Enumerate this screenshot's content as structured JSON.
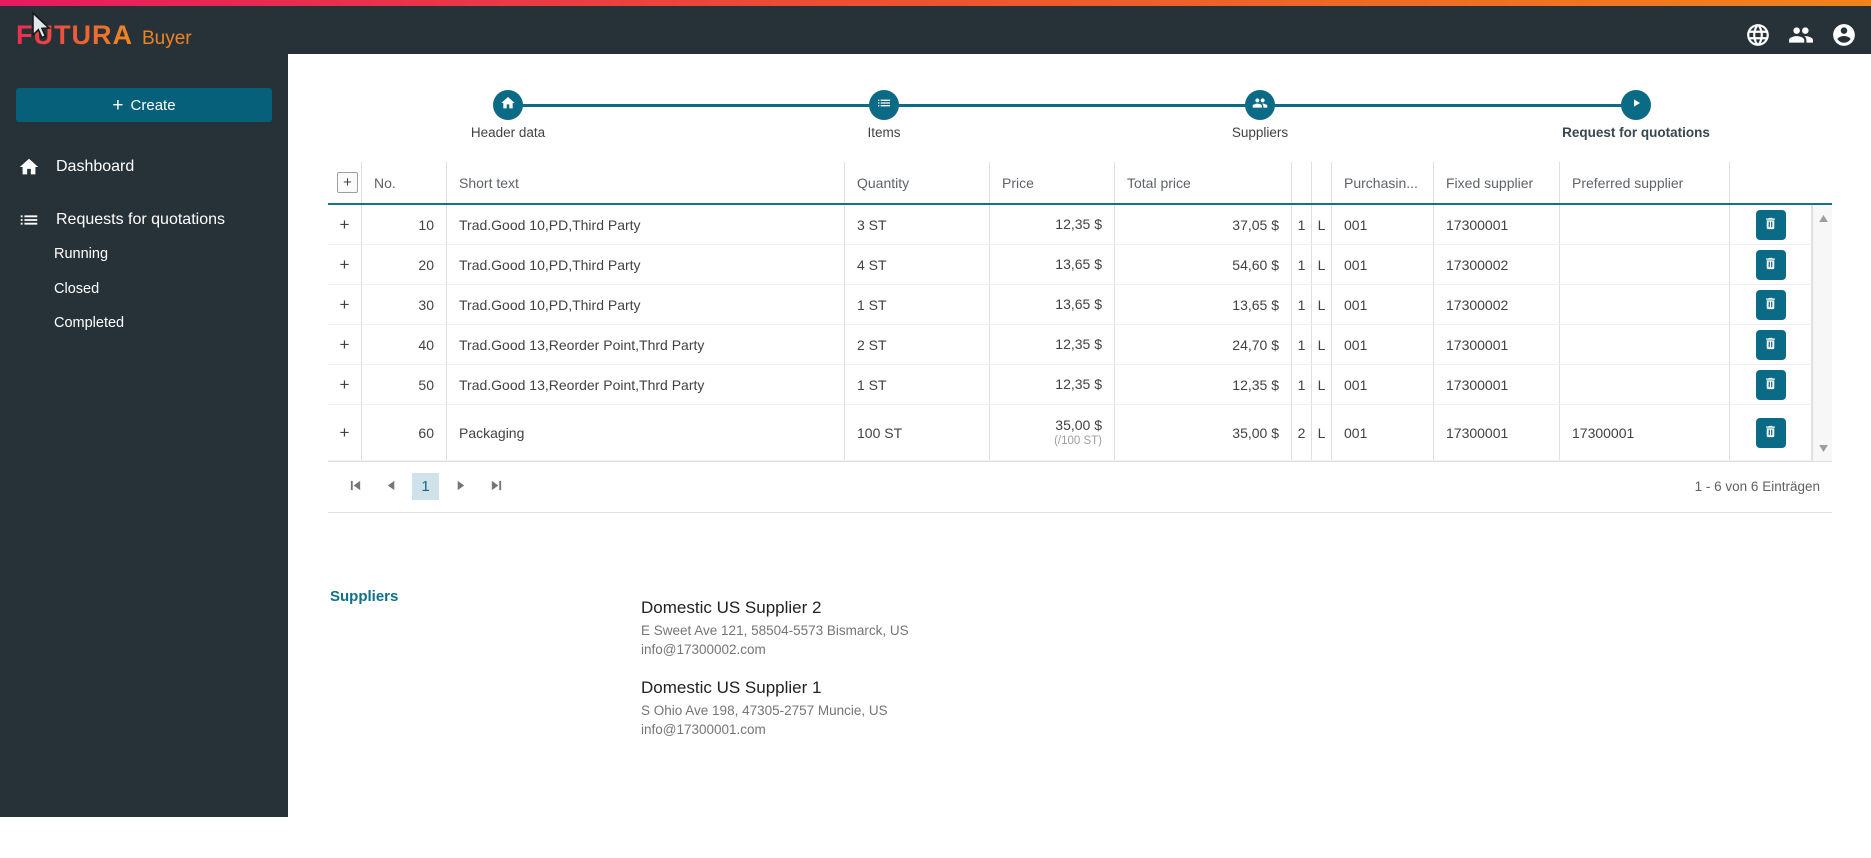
{
  "brand": {
    "name": "FUTURA",
    "suffix": "Buyer"
  },
  "colors": {
    "accent": "#0b6a85",
    "header_bg": "#263238",
    "strip_from": "#e61a5f",
    "strip_to": "#f0831c",
    "page_highlight": "#cfe2ea"
  },
  "icons": {
    "plus": "+",
    "header": [
      "globe-icon",
      "team-icon",
      "account-icon"
    ],
    "sidebar": [
      "home-icon",
      "list-icon"
    ],
    "stepper": [
      "home-icon",
      "list-icon",
      "group-icon",
      "play-circle-icon"
    ],
    "row_action": "trash-icon",
    "collapse": "chevron-left-icon"
  },
  "sidebar": {
    "create_label": "Create",
    "items": [
      {
        "label": "Dashboard"
      },
      {
        "label": "Requests for quotations"
      }
    ],
    "subitems": [
      "Running",
      "Closed",
      "Completed"
    ]
  },
  "stepper": {
    "steps": [
      {
        "label": "Header data"
      },
      {
        "label": "Items"
      },
      {
        "label": "Suppliers"
      },
      {
        "label": "Request for quotations"
      }
    ]
  },
  "table": {
    "headers": {
      "no": "No.",
      "short_text": "Short text",
      "quantity": "Quantity",
      "price": "Price",
      "total_price": "Total price",
      "purchasing": "Purchasin...",
      "fixed_supplier": "Fixed supplier",
      "preferred_supplier": "Preferred supplier"
    },
    "rows": [
      {
        "no": "10",
        "short_text": "Trad.Good 10,PD,Third Party",
        "quantity": "3 ST",
        "price": "12,35 $",
        "price_unit": "",
        "total": "37,05 $",
        "c1": "1",
        "c2": "L",
        "purchasing": "001",
        "fixed": "17300001",
        "preferred": ""
      },
      {
        "no": "20",
        "short_text": "Trad.Good 10,PD,Third Party",
        "quantity": "4 ST",
        "price": "13,65 $",
        "price_unit": "",
        "total": "54,60 $",
        "c1": "1",
        "c2": "L",
        "purchasing": "001",
        "fixed": "17300002",
        "preferred": ""
      },
      {
        "no": "30",
        "short_text": "Trad.Good 10,PD,Third Party",
        "quantity": "1 ST",
        "price": "13,65 $",
        "price_unit": "",
        "total": "13,65 $",
        "c1": "1",
        "c2": "L",
        "purchasing": "001",
        "fixed": "17300002",
        "preferred": ""
      },
      {
        "no": "40",
        "short_text": "Trad.Good 13,Reorder Point,Thrd Party",
        "quantity": "2 ST",
        "price": "12,35 $",
        "price_unit": "",
        "total": "24,70 $",
        "c1": "1",
        "c2": "L",
        "purchasing": "001",
        "fixed": "17300001",
        "preferred": ""
      },
      {
        "no": "50",
        "short_text": "Trad.Good 13,Reorder Point,Thrd Party",
        "quantity": "1 ST",
        "price": "12,35 $",
        "price_unit": "",
        "total": "12,35 $",
        "c1": "1",
        "c2": "L",
        "purchasing": "001",
        "fixed": "17300001",
        "preferred": ""
      },
      {
        "no": "60",
        "short_text": "Packaging",
        "quantity": "100 ST",
        "price": "35,00 $",
        "price_unit": "(/100 ST)",
        "total": "35,00 $",
        "c1": "2",
        "c2": "L",
        "purchasing": "001",
        "fixed": "17300001",
        "preferred": "17300001"
      }
    ]
  },
  "pagination": {
    "page": "1",
    "info": "1 - 6 von 6 Einträgen"
  },
  "suppliers": {
    "title": "Suppliers",
    "entries": [
      {
        "name": "Domestic US Supplier 2",
        "address": "E Sweet Ave 121, 58504-5573 Bismarck, US",
        "email": "info@17300002.com"
      },
      {
        "name": "Domestic US Supplier 1",
        "address": "S Ohio Ave 198, 47305-2757 Muncie, US",
        "email": "info@17300001.com"
      }
    ]
  }
}
